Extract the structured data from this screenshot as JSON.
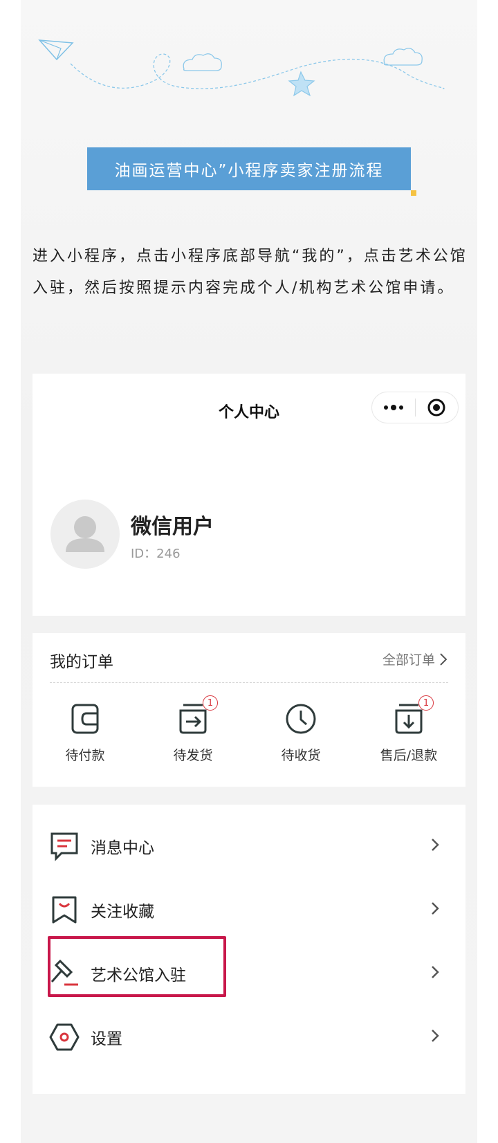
{
  "header": {
    "title": "油画运营中心”小程序卖家注册流程"
  },
  "intro": {
    "text": "进入小程序，点击小程序底部导航“我的”，点击艺术公馆入驻，然后按照提示内容完成个人/机构艺术公馆申请。"
  },
  "profile": {
    "nav_title": "个人中心",
    "more_icon": "more-dots-icon",
    "close_icon": "target-circle-icon",
    "username": "微信用户",
    "user_id": "ID：246"
  },
  "orders": {
    "title": "我的订单",
    "all_label": "全部订单",
    "items": [
      {
        "label": "待付款",
        "icon": "wallet-icon",
        "badge": ""
      },
      {
        "label": "待发货",
        "icon": "ship-out-icon",
        "badge": "1"
      },
      {
        "label": "待收货",
        "icon": "clock-icon",
        "badge": ""
      },
      {
        "label": "售后/退款",
        "icon": "refund-icon",
        "badge": "1"
      }
    ]
  },
  "menu": {
    "items": [
      {
        "label": "消息中心",
        "icon": "message-icon"
      },
      {
        "label": "关注收藏",
        "icon": "favorite-bookmark-icon"
      },
      {
        "label": "艺术公馆入驻",
        "icon": "gavel-icon"
      },
      {
        "label": "设置",
        "icon": "settings-hexagon-icon"
      }
    ]
  },
  "colors": {
    "title_bar": "#5a9fd6",
    "highlight": "#c8174a",
    "badge": "#d9363e",
    "icon_dark": "#2f3b3b",
    "icon_accent": "#d9363e"
  }
}
